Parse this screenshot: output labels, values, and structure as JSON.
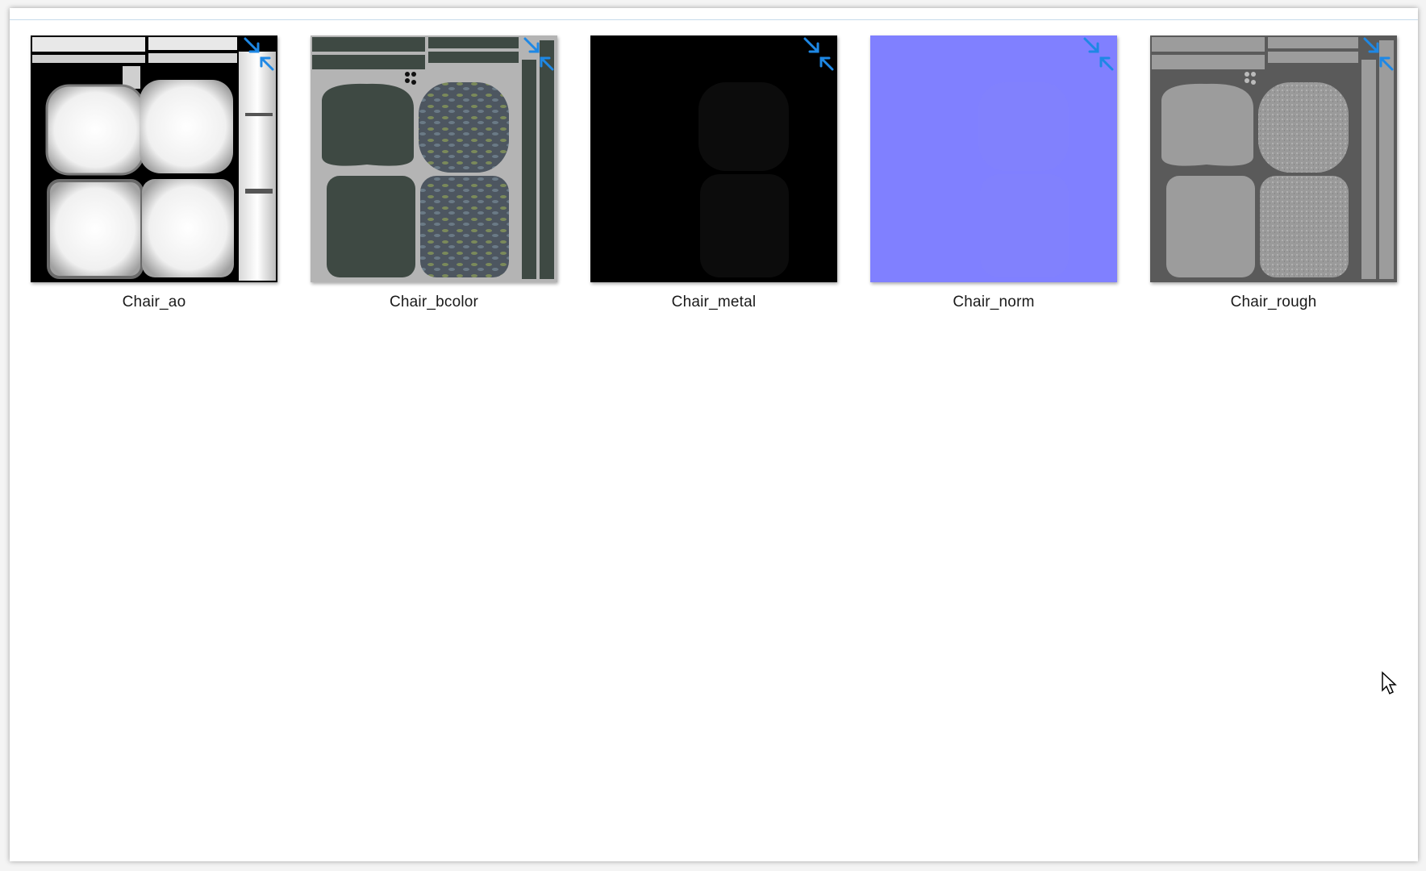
{
  "files": [
    {
      "name": "Chair_ao",
      "icon": "compressed-arrows-icon"
    },
    {
      "name": "Chair_bcolor",
      "icon": "compressed-arrows-icon"
    },
    {
      "name": "Chair_metal",
      "icon": "compressed-arrows-icon"
    },
    {
      "name": "Chair_norm",
      "icon": "compressed-arrows-icon"
    },
    {
      "name": "Chair_rough",
      "icon": "compressed-arrows-icon"
    }
  ],
  "colors": {
    "compress_icon": "#1e88e5",
    "norm_blue": "#8080ff",
    "bcolor_bg": "#b4b4b4",
    "bcolor_dark": "#3e4943",
    "rough_bg": "#5a5a5a",
    "rough_light": "#9c9c9c"
  }
}
